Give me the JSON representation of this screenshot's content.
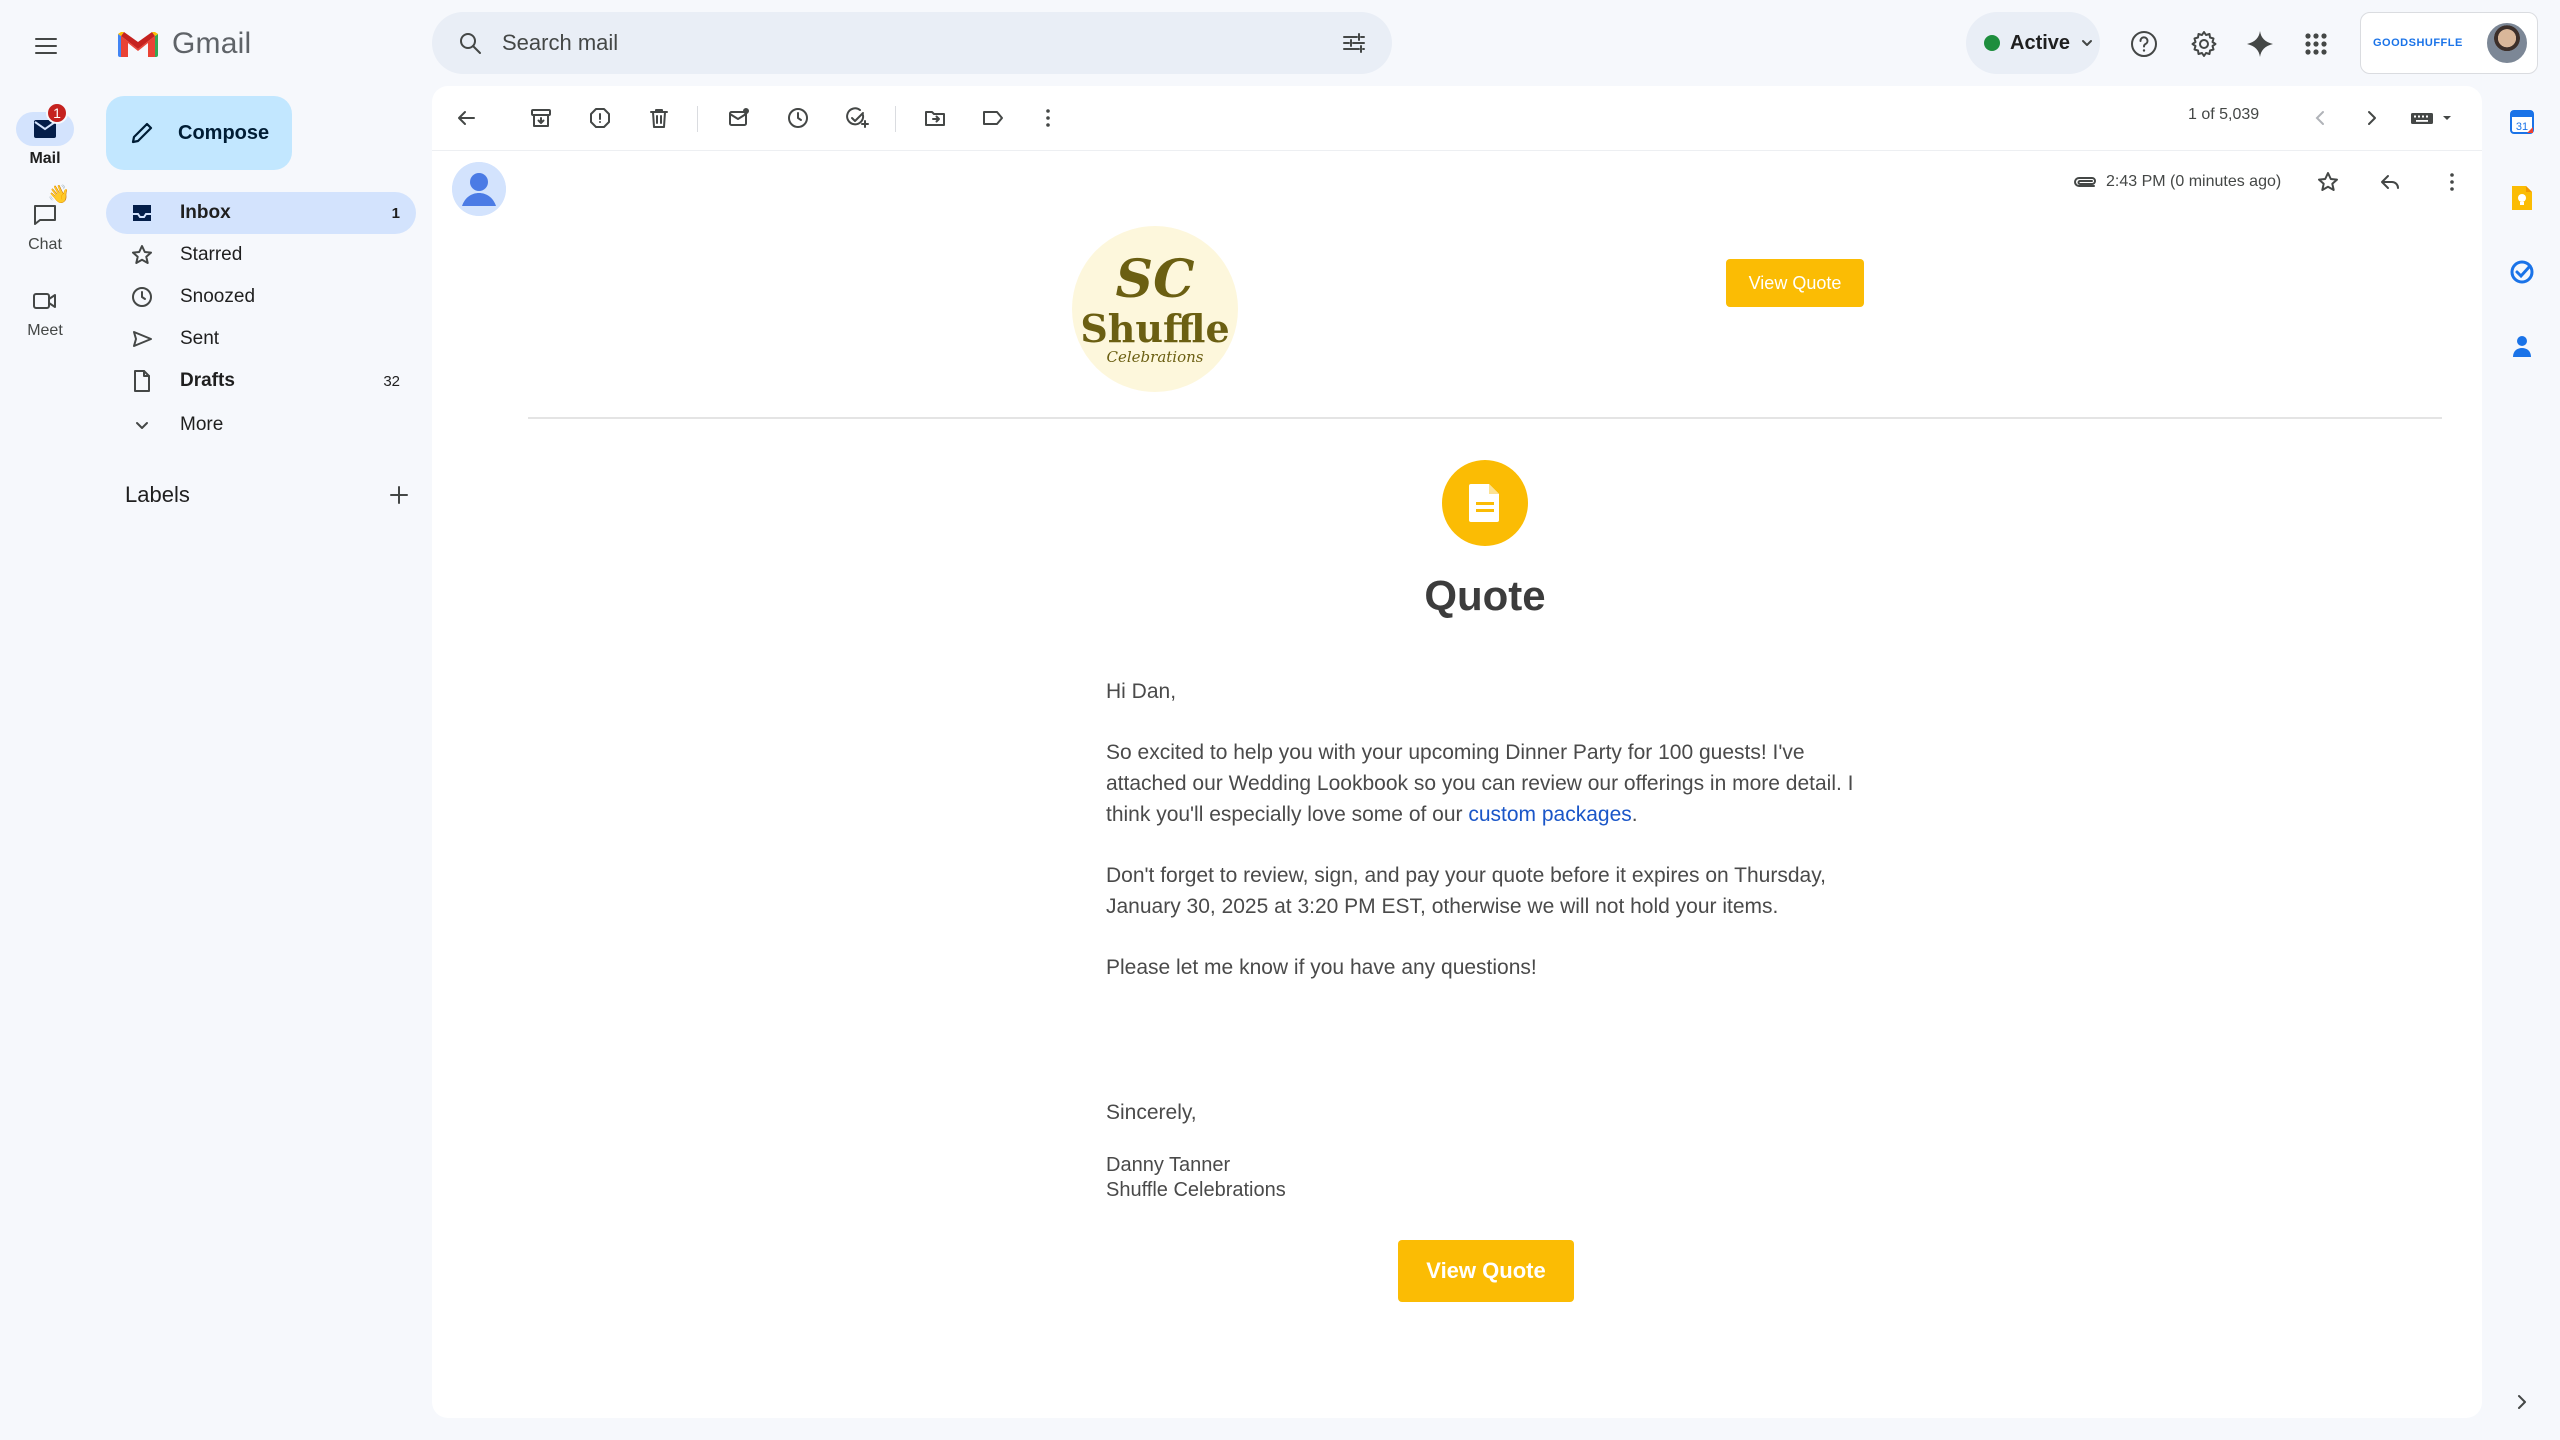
{
  "app": {
    "name": "Gmail"
  },
  "search": {
    "placeholder": "Search mail"
  },
  "status": {
    "label": "Active",
    "color": "#1e8e3e"
  },
  "account": {
    "brand": "GOODSHUFFLE"
  },
  "rail": {
    "mail": {
      "label": "Mail",
      "badge": "1"
    },
    "chat": {
      "label": "Chat"
    },
    "meet": {
      "label": "Meet"
    }
  },
  "compose": {
    "label": "Compose"
  },
  "nav": {
    "items": [
      {
        "label": "Inbox",
        "count": "1"
      },
      {
        "label": "Starred",
        "count": ""
      },
      {
        "label": "Snoozed",
        "count": ""
      },
      {
        "label": "Sent",
        "count": ""
      },
      {
        "label": "Drafts",
        "count": "32"
      },
      {
        "label": "More",
        "count": ""
      }
    ]
  },
  "labels": {
    "heading": "Labels"
  },
  "toolbar": {
    "pager": "1 of 5,039"
  },
  "message": {
    "time": "2:43 PM (0 minutes ago)",
    "logo": {
      "monogram": "SC",
      "name": "Shuffle",
      "sub": "Celebrations"
    },
    "view_quote_top": "View Quote",
    "title": "Quote",
    "greeting": "Hi Dan,",
    "para1_pre": "So excited to help you with your upcoming Dinner Party for 100 guests! I've attached our Wedding Lookbook so you can review our offerings in more detail. I think you'll especially love some of our ",
    "para1_link": "custom packages",
    "para1_post": ".",
    "para2": "Don't forget to review, sign, and pay your quote before it expires on Thursday, January 30, 2025 at 3:20 PM EST, otherwise we will not hold your items.",
    "para3": "Please let me know if you have any questions!",
    "closing": "Sincerely,",
    "sig_name": "Danny Tanner",
    "sig_company": "Shuffle Celebrations",
    "view_quote_bottom": "View Quote"
  },
  "colors": {
    "accent": "#fbbc04",
    "link": "#1a56c8",
    "compose_bg": "#c2e7ff",
    "selected_nav": "#d3e3fd"
  }
}
